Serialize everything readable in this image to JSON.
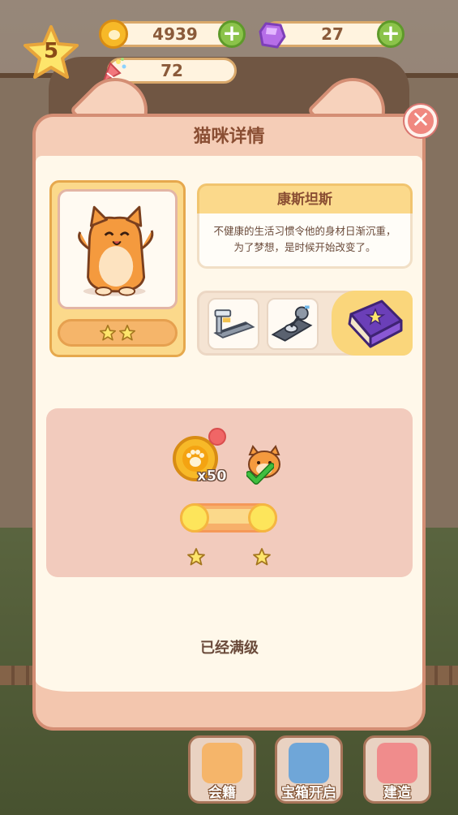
{
  "hud": {
    "level": "5",
    "coins": "4939",
    "gems": "27",
    "party": "72"
  },
  "modal": {
    "title": "猫咪详情",
    "cat_name": "康斯坦斯",
    "description_line1": "不健康的生活习惯令他的身材日渐沉重，",
    "description_line2": "为了梦想，是时候开始改变了。",
    "star_count": 2,
    "upgrade": {
      "cost_label": "x50",
      "progress": 1.0
    },
    "status": "已经满级"
  },
  "nav": {
    "item1": "会籍",
    "item2": "宝箱开启",
    "item3": "建造"
  },
  "colors": {
    "accent": "#fbd98b",
    "panel": "#fff8ea",
    "border": "#d48e74",
    "close": "#f08880",
    "check": "#3fbf3f"
  },
  "icons": [
    "coin-icon",
    "gem-icon",
    "party-popper-icon",
    "plus-icon",
    "close-icon",
    "star-icon",
    "book-icon",
    "treadmill-icon",
    "rowing-machine-icon",
    "paw-coin-icon",
    "check-icon"
  ]
}
